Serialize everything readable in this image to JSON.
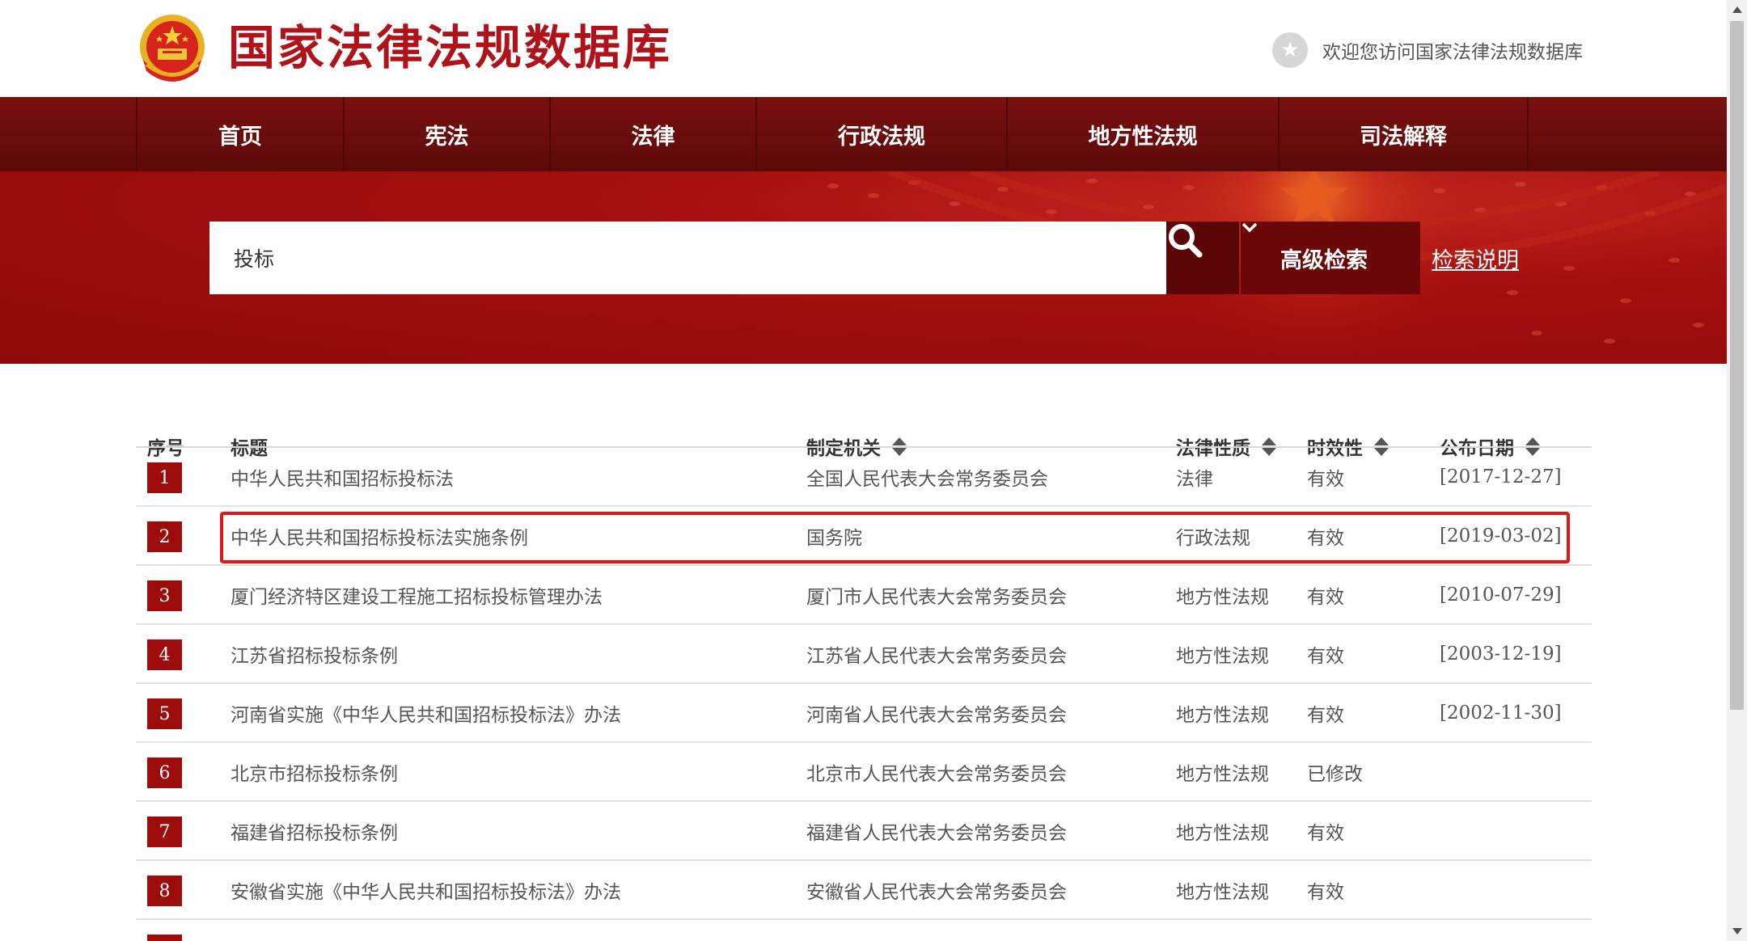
{
  "header": {
    "site_title": "国家法律法规数据库",
    "welcome_text": "欢迎您访问国家法律法规数据库",
    "emblem_icon": "national-emblem-icon",
    "star_icon": "star-icon"
  },
  "nav": {
    "items": [
      {
        "label": "首页"
      },
      {
        "label": "宪法"
      },
      {
        "label": "法律"
      },
      {
        "label": "行政法规"
      },
      {
        "label": "地方性法规"
      },
      {
        "label": "司法解释"
      }
    ]
  },
  "search": {
    "query": "投标",
    "search_icon": "search-icon",
    "advanced_label": "高级检索",
    "help_label": "检索说明"
  },
  "table": {
    "headers": {
      "index": "序号",
      "title": "标题",
      "authority": "制定机关",
      "nature": "法律性质",
      "validity": "时效性",
      "date": "公布日期"
    },
    "rows": [
      {
        "n": "1",
        "title": "中华人民共和国招标投标法",
        "authority": "全国人民代表大会常务委员会",
        "nature": "法律",
        "validity": "有效",
        "date": "[2017-12-27]"
      },
      {
        "n": "2",
        "title": "中华人民共和国招标投标法实施条例",
        "authority": "国务院",
        "nature": "行政法规",
        "validity": "有效",
        "date": "[2019-03-02]"
      },
      {
        "n": "3",
        "title": "厦门经济特区建设工程施工招标投标管理办法",
        "authority": "厦门市人民代表大会常务委员会",
        "nature": "地方性法规",
        "validity": "有效",
        "date": "[2010-07-29]"
      },
      {
        "n": "4",
        "title": "江苏省招标投标条例",
        "authority": "江苏省人民代表大会常务委员会",
        "nature": "地方性法规",
        "validity": "有效",
        "date": "[2003-12-19]"
      },
      {
        "n": "5",
        "title": "河南省实施《中华人民共和国招标投标法》办法",
        "authority": "河南省人民代表大会常务委员会",
        "nature": "地方性法规",
        "validity": "有效",
        "date": "[2002-11-30]"
      },
      {
        "n": "6",
        "title": "北京市招标投标条例",
        "authority": "北京市人民代表大会常务委员会",
        "nature": "地方性法规",
        "validity": "已修改",
        "date": ""
      },
      {
        "n": "7",
        "title": "福建省招标投标条例",
        "authority": "福建省人民代表大会常务委员会",
        "nature": "地方性法规",
        "validity": "有效",
        "date": ""
      },
      {
        "n": "8",
        "title": "安徽省实施《中华人民共和国招标投标法》办法",
        "authority": "安徽省人民代表大会常务委员会",
        "nature": "地方性法规",
        "validity": "有效",
        "date": ""
      }
    ]
  },
  "colors": {
    "brand_red": "#b0121a",
    "nav_bg": "#6e0e0e",
    "banner_red": "#a50f0f",
    "badge_red": "#9d0b0b",
    "highlight": "#e01818"
  }
}
